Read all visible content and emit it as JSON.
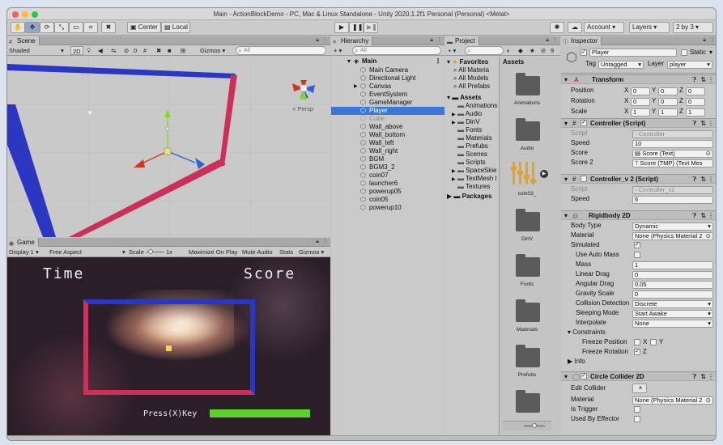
{
  "window": {
    "title": "Main - ActionBlockDemo - PC, Mac & Linux Standalone - Unity 2020.1.2f1 Personal (Personal) <Metal>"
  },
  "toolbar": {
    "center_label": "Center",
    "local_label": "Local",
    "account_label": "Account",
    "layers_label": "Layers",
    "layout_label": "2 by 3"
  },
  "scene": {
    "tab_label": "Scene",
    "shading": "Shaded",
    "mode_2d": "2D",
    "effects_count": "0",
    "gizmos_label": "Gizmos",
    "search_placeholder": "All",
    "persp_label": "< Persp"
  },
  "game": {
    "tab_label": "Game",
    "display": "Display 1",
    "aspect": "Free Aspect",
    "scale_label": "Scale",
    "scale_value": "1x",
    "maximize_label": "Maximize On Play",
    "mute_label": "Mute Audio",
    "stats_label": "Stats",
    "gizmos_label": "Gizmos",
    "hud_time": "Time",
    "hud_score": "Score",
    "press_key": "Press(X)Key",
    "progress": 1.0
  },
  "hierarchy": {
    "tab_label": "Hierarchy",
    "search_placeholder": "All",
    "scene_name": "Main",
    "items": [
      {
        "label": "Main Camera",
        "active": true,
        "selected": false,
        "arrow": ""
      },
      {
        "label": "Directional Light",
        "active": true,
        "selected": false,
        "arrow": ""
      },
      {
        "label": "Canvas",
        "active": true,
        "selected": false,
        "arrow": "▶"
      },
      {
        "label": "EventSystem",
        "active": true,
        "selected": false,
        "arrow": ""
      },
      {
        "label": "GameManager",
        "active": true,
        "selected": false,
        "arrow": ""
      },
      {
        "label": "Player",
        "active": true,
        "selected": true,
        "arrow": ""
      },
      {
        "label": "Cube",
        "active": false,
        "selected": false,
        "arrow": ""
      },
      {
        "label": "Wall_above",
        "active": true,
        "selected": false,
        "arrow": ""
      },
      {
        "label": "Wall_bottom",
        "active": true,
        "selected": false,
        "arrow": ""
      },
      {
        "label": "Wall_left",
        "active": true,
        "selected": false,
        "arrow": ""
      },
      {
        "label": "Wall_right",
        "active": true,
        "selected": false,
        "arrow": ""
      },
      {
        "label": "BGM",
        "active": true,
        "selected": false,
        "arrow": ""
      },
      {
        "label": "BGM3_2",
        "active": true,
        "selected": false,
        "arrow": ""
      },
      {
        "label": "coin07",
        "active": true,
        "selected": false,
        "arrow": ""
      },
      {
        "label": "launcher6",
        "active": true,
        "selected": false,
        "arrow": ""
      },
      {
        "label": "powerup05",
        "active": true,
        "selected": false,
        "arrow": ""
      },
      {
        "label": "coin05",
        "active": true,
        "selected": false,
        "arrow": ""
      },
      {
        "label": "powerup10",
        "active": true,
        "selected": false,
        "arrow": ""
      }
    ]
  },
  "project": {
    "tab_label": "Project",
    "favorites_label": "Favorites",
    "favorites": [
      "All Materia",
      "All Models",
      "All Prefabs"
    ],
    "assets_label": "Assets",
    "tree": [
      {
        "label": "Animations",
        "arrow": ""
      },
      {
        "label": "Audio",
        "arrow": "▶"
      },
      {
        "label": "DinV",
        "arrow": "▶"
      },
      {
        "label": "Fonts",
        "arrow": ""
      },
      {
        "label": "Materials",
        "arrow": ""
      },
      {
        "label": "Prefubs",
        "arrow": ""
      },
      {
        "label": "Scenes",
        "arrow": ""
      },
      {
        "label": "Scripts",
        "arrow": ""
      },
      {
        "label": "SpaceSkie",
        "arrow": "▶"
      },
      {
        "label": "TextMesh I",
        "arrow": "▶"
      },
      {
        "label": "Textures",
        "arrow": ""
      }
    ],
    "packages_label": "Packages",
    "grid_header": "Assets",
    "grid_count": "9",
    "grid": [
      {
        "label": "Animations",
        "kind": "folder"
      },
      {
        "label": "Audio",
        "kind": "folder"
      },
      {
        "label": "coin03_",
        "kind": "audio"
      },
      {
        "label": "DinV",
        "kind": "folder"
      },
      {
        "label": "Fonts",
        "kind": "folder"
      },
      {
        "label": "Materials",
        "kind": "folder"
      },
      {
        "label": "Prefubs",
        "kind": "folder"
      },
      {
        "label": "",
        "kind": "folder"
      }
    ]
  },
  "inspector": {
    "tab_label": "Inspector",
    "object_name": "Player",
    "static_label": "Static",
    "tag_label": "Tag",
    "tag_value": "Untagged",
    "layer_label": "Layer",
    "layer_value": "player",
    "transform": {
      "title": "Transform",
      "rows": [
        {
          "label": "Position",
          "x": "0",
          "y": "0",
          "z": "0"
        },
        {
          "label": "Rotation",
          "x": "0",
          "y": "0",
          "z": "0"
        },
        {
          "label": "Scale",
          "x": "1",
          "y": "1",
          "z": "1"
        }
      ]
    },
    "controller": {
      "title": "Controller (Script)",
      "script_label": "Script",
      "script_value": "Controller",
      "speed_label": "Speed",
      "speed_value": "10",
      "score_label": "Score",
      "score_value": "Score (Text)",
      "score2_label": "Score 2",
      "score2_value": "Score (TMP) (Text Mes"
    },
    "controller_v2": {
      "title": "Controller_v 2 (Script)",
      "script_label": "Script",
      "script_value": "Controller_v2",
      "speed_label": "Speed",
      "speed_value": "6"
    },
    "rigidbody": {
      "title": "Rigidbody 2D",
      "body_type_label": "Body Type",
      "body_type_value": "Dynamic",
      "material_label": "Material",
      "material_value": "None (Physics Material 2",
      "simulated_label": "Simulated",
      "auto_mass_label": "Use Auto Mass",
      "mass_label": "Mass",
      "mass_value": "1",
      "linear_drag_label": "Linear Drag",
      "linear_drag_value": "0",
      "angular_drag_label": "Angular Drag",
      "angular_drag_value": "0.05",
      "gravity_label": "Gravity Scale",
      "gravity_value": "0",
      "collision_label": "Collision Detection",
      "collision_value": "Discrete",
      "sleeping_label": "Sleeping Mode",
      "sleeping_value": "Start Awake",
      "interpolate_label": "Interpolate",
      "interpolate_value": "None",
      "constraints_label": "Constraints",
      "freeze_pos_label": "Freeze Position",
      "freeze_rot_label": "Freeze Rotation",
      "x_label": "X",
      "y_label": "Y",
      "z_label": "Z",
      "info_label": "Info"
    },
    "circle": {
      "title": "Circle Collider 2D",
      "edit_label": "Edit Collider",
      "material_label": "Material",
      "material_value": "None (Physics Material 2",
      "trigger_label": "Is Trigger",
      "effector_label": "Used By Effector"
    }
  },
  "colors": {
    "selection": "#3b77d6",
    "wall_red": "#cc2f5a",
    "wall_blue": "#2b36c2",
    "progress_green": "#5cd12d"
  }
}
